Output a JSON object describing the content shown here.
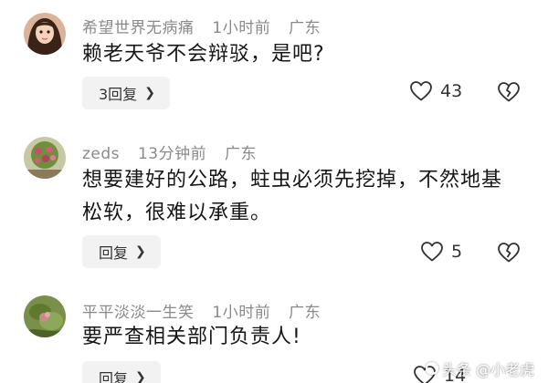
{
  "comments": [
    {
      "username": "希望世界无病痛",
      "time": "1小时前",
      "location": "广东",
      "text": "赖老天爷不会辩驳，是吧?",
      "reply_label": "3回复",
      "likes": "43"
    },
    {
      "username": "zeds",
      "time": "13分钟前",
      "location": "广东",
      "text": "想要建好的公路，蛀虫必须先挖掉，不然地基松软，很难以承重。",
      "reply_label": "回复",
      "likes": "5"
    },
    {
      "username": "平平淡淡一生笑",
      "time": "1小时前",
      "location": "广东",
      "text": "要严查相关部门负责人!",
      "reply_label": "回复",
      "likes": "14"
    }
  ],
  "watermark": {
    "text": "头条 @小老虎"
  },
  "icons": {
    "reply_chevron": "chevron-right-icon",
    "like": "heart-icon",
    "dislike": "broken-heart-icon"
  }
}
